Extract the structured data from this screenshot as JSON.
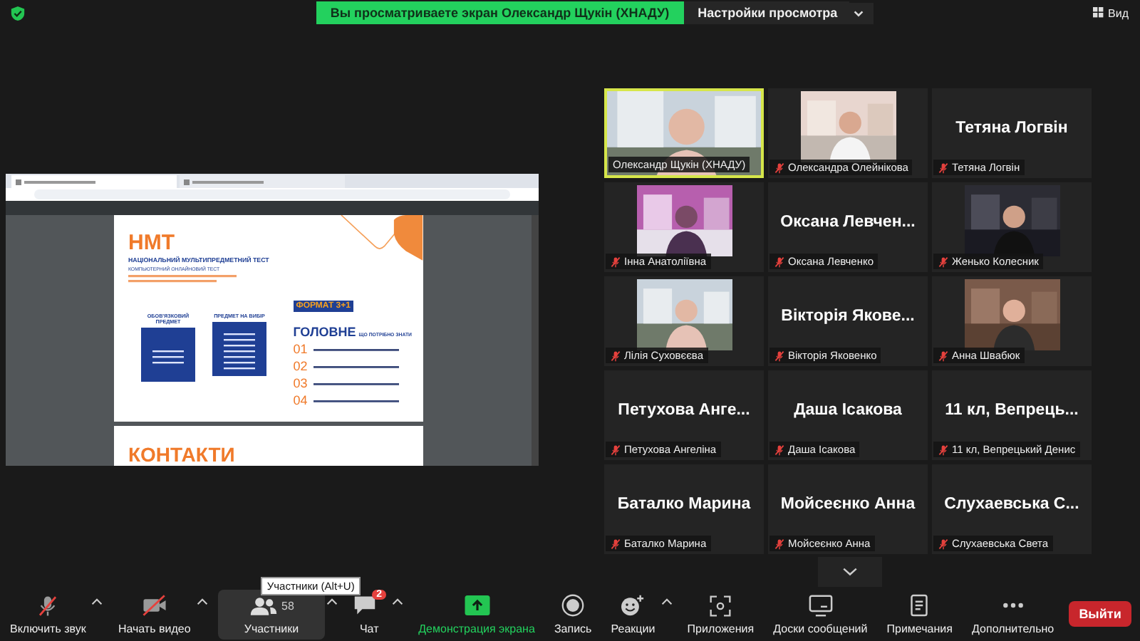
{
  "top_bar": {
    "banner": "Вы просматриваете экран Олександр Щукін (ХНАДУ)",
    "view_settings": "Настройки просмотра",
    "view": "Вид"
  },
  "shared_screen": {
    "title": "НМТ",
    "subtitle": "НАЦІОНАЛЬНИЙ МУЛЬТИПРЕДМЕТНИЙ ТЕСТ",
    "caption": "КОМПЬЮТЕРНИЙ ОНЛАЙНОВИЙ ТЕСТ",
    "columns": [
      "ОБОВ'ЯЗКОВИЙ ПРЕДМЕТ",
      "ПРЕДМЕТ НА ВИБІР"
    ],
    "format_badge": "ФОРМАТ 3+1",
    "heading": "ГОЛОВНЕ",
    "heading_note": "ЩО ПОТРІБНО ЗНАТИ",
    "points": [
      "01",
      "02",
      "03",
      "04"
    ],
    "next_page_title": "КОНТАКТИ"
  },
  "tiles": [
    {
      "kind": "video",
      "name": "Олександр Щукін (ХНАДУ)",
      "muted": false,
      "speaking": true
    },
    {
      "kind": "video",
      "name": "Олександра Олейнікова",
      "muted": true,
      "speaking": false
    },
    {
      "kind": "name",
      "big_name": "Тетяна Логвін",
      "name": "Тетяна Логвін",
      "muted": true,
      "speaking": false
    },
    {
      "kind": "video",
      "name": "Інна Анатоліївна",
      "muted": true,
      "speaking": false
    },
    {
      "kind": "name",
      "big_name": "Оксана Левчен...",
      "name": "Оксана Левченко",
      "muted": true,
      "speaking": false
    },
    {
      "kind": "video",
      "name": "Женько Колесник",
      "muted": true,
      "speaking": false
    },
    {
      "kind": "video",
      "name": "Лілія Суховєєва",
      "muted": true,
      "speaking": false
    },
    {
      "kind": "name",
      "big_name": "Вікторія Якове...",
      "name": "Вікторія Яковенко",
      "muted": true,
      "speaking": false
    },
    {
      "kind": "video",
      "name": "Анна Швабюк",
      "muted": true,
      "speaking": false
    },
    {
      "kind": "name",
      "big_name": "Петухова Анге...",
      "name": "Петухова Ангеліна",
      "muted": true,
      "speaking": false
    },
    {
      "kind": "name",
      "big_name": "Даша Ісакова",
      "name": "Даша Ісакова",
      "muted": true,
      "speaking": false
    },
    {
      "kind": "name",
      "big_name": "11 кл, Вепрець...",
      "name": "11 кл, Вепрецький Денис",
      "muted": true,
      "speaking": false
    },
    {
      "kind": "name",
      "big_name": "Баталко Марина",
      "name": "Баталко Марина",
      "muted": true,
      "speaking": false
    },
    {
      "kind": "name",
      "big_name": "Мойсеєнко Анна",
      "name": "Мойсеєнко Анна",
      "muted": true,
      "speaking": false
    },
    {
      "kind": "name",
      "big_name": "Слухаевська С...",
      "name": "Слухаевська Света",
      "muted": true,
      "speaking": false
    }
  ],
  "toolbar": {
    "items": [
      {
        "kind": "mic",
        "label": "Включить звук",
        "caret": true,
        "selected": false
      },
      {
        "kind": "camera",
        "label": "Начать видео",
        "caret": true,
        "selected": false
      },
      {
        "kind": "participants",
        "label": "Участники",
        "count": "58",
        "caret": true,
        "selected": true,
        "tooltip": "Участники (Alt+U)"
      },
      {
        "kind": "chat",
        "label": "Чат",
        "badge": "2",
        "caret": true,
        "selected": false
      },
      {
        "kind": "share",
        "label": "Демонстрация экрана",
        "caret": false,
        "selected": false
      },
      {
        "kind": "record",
        "label": "Запись",
        "caret": false,
        "selected": false
      },
      {
        "kind": "reactions",
        "label": "Реакции",
        "caret": true,
        "selected": false
      },
      {
        "kind": "apps",
        "label": "Приложения",
        "caret": false,
        "selected": false
      },
      {
        "kind": "boards",
        "label": "Доски сообщений",
        "caret": false,
        "selected": false
      },
      {
        "kind": "notes",
        "label": "Примечания",
        "caret": false,
        "selected": false
      },
      {
        "kind": "more",
        "label": "Дополнительно",
        "caret": false,
        "selected": false
      }
    ],
    "leave": "Выйти"
  }
}
